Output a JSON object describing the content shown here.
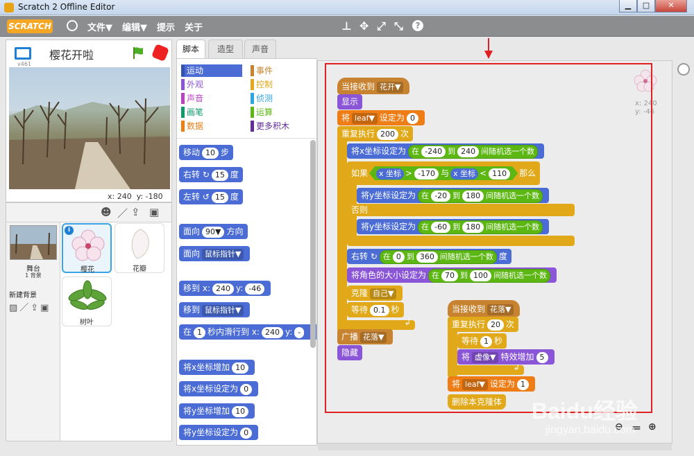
{
  "window": {
    "title": "Scratch 2 Offline Editor"
  },
  "menu": {
    "logo": "SCRATCH",
    "file": "文件▼",
    "edit": "编辑▼",
    "tips": "提示",
    "about": "关于"
  },
  "stage": {
    "title": "樱花开啦",
    "version": "v461",
    "x_label": "x:",
    "x_value": "240",
    "y_label": "y:",
    "y_value": "-180"
  },
  "sprites": {
    "stage_label": "舞台",
    "stage_sub": "1 背景",
    "new_backdrop": "新建背景",
    "items": [
      "樱花",
      "花瓣",
      "树叶"
    ]
  },
  "tabs": [
    "脚本",
    "造型",
    "声音"
  ],
  "categories": [
    {
      "label": "运动",
      "color": "#4a6cd4"
    },
    {
      "label": "外观",
      "color": "#8a55d7"
    },
    {
      "label": "声音",
      "color": "#bb42c3"
    },
    {
      "label": "画笔",
      "color": "#0e9a6c"
    },
    {
      "label": "数据",
      "color": "#ee7d16"
    },
    {
      "label": "事件",
      "color": "#c88330"
    },
    {
      "label": "控制",
      "color": "#e1a91a"
    },
    {
      "label": "侦测",
      "color": "#2ca5e2"
    },
    {
      "label": "运算",
      "color": "#5cb712"
    },
    {
      "label": "更多积木",
      "color": "#632d99"
    }
  ],
  "palette": {
    "move": [
      "移动",
      "10",
      "步"
    ],
    "turn_right": [
      "右转",
      "15",
      "度"
    ],
    "turn_left": [
      "左转",
      "15",
      "度"
    ],
    "point_dir": [
      "面向",
      "90▼",
      "方向"
    ],
    "point_towards": [
      "面向",
      "鼠标指针▼"
    ],
    "goto_xy": [
      "移到",
      "x:",
      "240",
      "y:",
      "-46"
    ],
    "goto": [
      "移到",
      "鼠标指针▼"
    ],
    "glide": [
      "在",
      "1",
      "秒内滑行到",
      "x:",
      "240",
      "y:",
      "-"
    ],
    "change_x": [
      "将x坐标增加",
      "10"
    ],
    "set_x": [
      "将x坐标设定为",
      "0"
    ],
    "change_y": [
      "将y坐标增加",
      "10"
    ],
    "set_y": [
      "将y坐标设定为",
      "0"
    ]
  },
  "script1": {
    "hat": [
      "当接收到",
      "花开▼"
    ],
    "show": "显示",
    "set_var": [
      "将",
      "leaf▼",
      "设定为",
      "0"
    ],
    "repeat": [
      "重复执行",
      "200",
      "次"
    ],
    "setx": [
      "将x坐标设定为",
      "在",
      "-240",
      "到",
      "240",
      "间随机选一个数"
    ],
    "if": [
      "如果",
      "x 坐标",
      ">",
      "-170",
      "与",
      "x 坐标",
      "<",
      "110",
      "那么"
    ],
    "sety1": [
      "将y坐标设定为",
      "在",
      "-20",
      "到",
      "180",
      "间随机选一个数"
    ],
    "else": "否则",
    "sety2": [
      "将y坐标设定为",
      "在",
      "-60",
      "到",
      "180",
      "间随机选一个数"
    ],
    "turn": [
      "右转",
      "在",
      "0",
      "到",
      "360",
      "间随机选一个数",
      "度"
    ],
    "size": [
      "将角色的大小设定为",
      "在",
      "70",
      "到",
      "100",
      "间随机选一个数"
    ],
    "clone": [
      "克隆",
      "自己▼"
    ],
    "wait": [
      "等待",
      "0.1",
      "秒"
    ],
    "broadcast": [
      "广播",
      "花落▼"
    ],
    "hide": "隐藏"
  },
  "script2": {
    "hat": [
      "当接收到",
      "花落▼"
    ],
    "repeat": [
      "重复执行",
      "20",
      "次"
    ],
    "wait": [
      "等待",
      "1",
      "秒"
    ],
    "effect": [
      "将",
      "虚像▼",
      "特效增加",
      "5"
    ],
    "set_var": [
      "将",
      "leaf▼",
      "设定为",
      "1"
    ],
    "delete": "删除本克隆体"
  },
  "sprite_info": {
    "x": "x: 240",
    "y": "y: -46"
  },
  "watermark": {
    "main": "Baidu经验",
    "sub": "jingyan.baidu.com"
  }
}
